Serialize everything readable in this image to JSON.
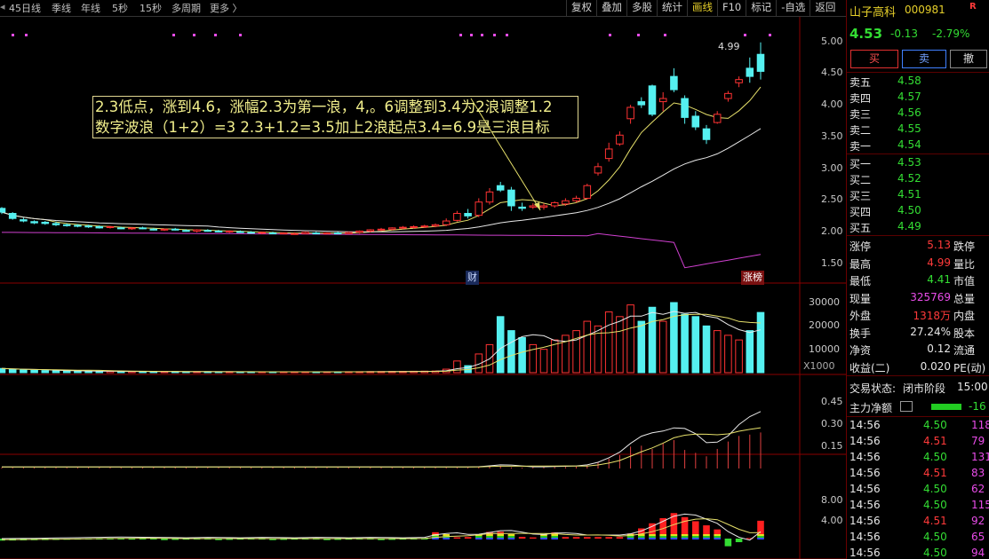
{
  "toolbar": {
    "left_items": [
      "45日线",
      "季线",
      "年线",
      "5秒",
      "15秒",
      "多周期",
      "更多 〉"
    ],
    "right_tabs": [
      "复权",
      "叠加",
      "多股",
      "统计",
      "画线",
      "F10",
      "标记",
      "-自选",
      "返回"
    ],
    "active_tab": "画线"
  },
  "annotation": {
    "line1": "2.3低点，涨到4.6，涨幅2.3为第一浪，4,。6调整到3.4为2浪调整1.2",
    "line2": "数字波浪（1+2）=3   2.3+1.2=3.5加上2浪起点3.4=6.9是三浪目标"
  },
  "labels": {
    "cai": "财",
    "zhangbang": "涨榜",
    "x1000": "X1000"
  },
  "axes": {
    "price": [
      "5.00",
      "4.50",
      "4.00",
      "3.50",
      "3.00",
      "2.50",
      "2.00",
      "1.50"
    ],
    "volume": [
      "30000",
      "20000",
      "10000"
    ],
    "ind1": [
      "0.45",
      "0.30",
      "0.15"
    ],
    "ind2": [
      "8.00",
      "4.00"
    ]
  },
  "chart_data": {
    "type": "candlestick",
    "high_label": "4.99",
    "candles": [
      [
        2.36,
        2.38,
        2.27,
        2.3
      ],
      [
        2.28,
        2.3,
        2.18,
        2.2
      ],
      [
        2.18,
        2.21,
        2.14,
        2.16
      ],
      [
        2.15,
        2.17,
        2.11,
        2.13
      ],
      [
        2.14,
        2.16,
        2.1,
        2.12
      ],
      [
        2.12,
        2.15,
        2.08,
        2.1
      ],
      [
        2.1,
        2.12,
        2.07,
        2.09
      ],
      [
        2.09,
        2.11,
        2.06,
        2.08
      ],
      [
        2.08,
        2.1,
        2.05,
        2.07
      ],
      [
        2.07,
        2.09,
        2.04,
        2.05
      ],
      [
        2.06,
        2.08,
        2.04,
        2.07
      ],
      [
        2.05,
        2.07,
        2.03,
        2.04
      ],
      [
        2.04,
        2.06,
        2.02,
        2.05
      ],
      [
        2.05,
        2.07,
        2.03,
        2.04
      ],
      [
        2.03,
        2.05,
        2.01,
        2.02
      ],
      [
        2.02,
        2.04,
        2.0,
        2.03
      ],
      [
        2.03,
        2.05,
        2.01,
        2.02
      ],
      [
        2.01,
        2.03,
        1.99,
        2.0
      ],
      [
        2.0,
        2.03,
        1.98,
        2.02
      ],
      [
        2.01,
        2.03,
        1.99,
        2.0
      ],
      [
        2.0,
        2.02,
        1.98,
        1.99
      ],
      [
        1.99,
        2.01,
        1.97,
        2.0
      ],
      [
        1.99,
        2.01,
        1.97,
        1.98
      ],
      [
        1.98,
        2.0,
        1.96,
        1.97
      ],
      [
        1.97,
        1.99,
        1.95,
        1.98
      ],
      [
        1.97,
        1.99,
        1.95,
        1.96
      ],
      [
        1.96,
        1.98,
        1.95,
        1.97
      ],
      [
        1.96,
        1.98,
        1.95,
        1.96
      ],
      [
        1.96,
        1.99,
        1.95,
        1.98
      ],
      [
        1.97,
        1.99,
        1.95,
        1.96
      ],
      [
        1.96,
        1.98,
        1.95,
        1.97
      ],
      [
        1.97,
        1.99,
        1.95,
        1.96
      ],
      [
        1.96,
        1.99,
        1.95,
        1.98
      ],
      [
        1.98,
        2.01,
        1.96,
        2.0
      ],
      [
        2.0,
        2.03,
        1.98,
        2.02
      ],
      [
        2.02,
        2.05,
        2.0,
        2.03
      ],
      [
        2.03,
        2.06,
        2.01,
        2.05
      ],
      [
        2.05,
        2.08,
        2.03,
        2.06
      ],
      [
        2.06,
        2.09,
        2.04,
        2.07
      ],
      [
        2.07,
        2.1,
        2.05,
        2.08
      ],
      [
        2.08,
        2.12,
        2.06,
        2.1
      ],
      [
        2.1,
        2.2,
        2.08,
        2.16
      ],
      [
        2.17,
        2.32,
        2.15,
        2.28
      ],
      [
        2.28,
        2.35,
        2.2,
        2.24
      ],
      [
        2.25,
        2.52,
        2.22,
        2.46
      ],
      [
        2.46,
        2.68,
        2.42,
        2.62
      ],
      [
        2.72,
        2.78,
        2.62,
        2.65
      ],
      [
        2.65,
        2.7,
        2.32,
        2.4
      ],
      [
        2.38,
        2.45,
        2.32,
        2.36
      ],
      [
        2.38,
        2.44,
        2.35,
        2.4
      ],
      [
        2.38,
        2.44,
        2.34,
        2.4
      ],
      [
        2.4,
        2.47,
        2.37,
        2.45
      ],
      [
        2.43,
        2.52,
        2.4,
        2.48
      ],
      [
        2.48,
        2.56,
        2.45,
        2.52
      ],
      [
        2.52,
        2.75,
        2.5,
        2.72
      ],
      [
        2.92,
        3.08,
        2.88,
        3.02
      ],
      [
        3.15,
        3.4,
        3.1,
        3.3
      ],
      [
        3.38,
        3.58,
        3.35,
        3.52
      ],
      [
        3.78,
        4.0,
        3.7,
        3.96
      ],
      [
        4.05,
        4.12,
        3.95,
        4.0
      ],
      [
        4.3,
        4.32,
        3.82,
        3.85
      ],
      [
        4.05,
        4.2,
        3.9,
        4.1
      ],
      [
        4.45,
        4.58,
        4.2,
        4.24
      ],
      [
        4.1,
        4.15,
        3.7,
        3.8
      ],
      [
        3.82,
        3.9,
        3.6,
        3.65
      ],
      [
        3.62,
        3.68,
        3.38,
        3.45
      ],
      [
        3.72,
        3.9,
        3.7,
        3.85
      ],
      [
        4.1,
        4.22,
        4.05,
        4.18
      ],
      [
        4.35,
        4.45,
        4.28,
        4.4
      ],
      [
        4.58,
        4.75,
        4.35,
        4.45
      ],
      [
        4.8,
        4.99,
        4.4,
        4.53
      ]
    ],
    "volume": [
      1800,
      1500,
      1200,
      1000,
      900,
      800,
      700,
      650,
      600,
      580,
      550,
      500,
      480,
      460,
      450,
      440,
      420,
      400,
      420,
      400,
      380,
      400,
      380,
      360,
      380,
      360,
      350,
      360,
      380,
      360,
      350,
      380,
      400,
      420,
      450,
      480,
      500,
      550,
      600,
      650,
      700,
      1500,
      5000,
      3000,
      8000,
      12000,
      24000,
      18000,
      15000,
      12000,
      10000,
      14000,
      16000,
      18000,
      22000,
      20000,
      26000,
      24000,
      29000,
      22000,
      28000,
      22000,
      30000,
      25000,
      24000,
      20000,
      18000,
      16000,
      14000,
      18000,
      25769
    ]
  },
  "panel": {
    "stock_name": "山子高科",
    "stock_code": "000981",
    "r_badge": "R",
    "price": "4.53",
    "change": "-0.13",
    "change_pct": "-2.79%",
    "buy_btn": "买",
    "sell_btn": "卖",
    "cancel_btn": "撤",
    "sells": [
      {
        "label": "卖五",
        "price": "4.58"
      },
      {
        "label": "卖四",
        "price": "4.57"
      },
      {
        "label": "卖三",
        "price": "4.56"
      },
      {
        "label": "卖二",
        "price": "4.55"
      },
      {
        "label": "卖一",
        "price": "4.54"
      }
    ],
    "buys": [
      {
        "label": "买一",
        "price": "4.53"
      },
      {
        "label": "买二",
        "price": "4.52"
      },
      {
        "label": "买三",
        "price": "4.51"
      },
      {
        "label": "买四",
        "price": "4.50"
      },
      {
        "label": "买五",
        "price": "4.49"
      }
    ],
    "stats": [
      {
        "l1": "涨停",
        "v1": "5.13",
        "l2": "跌停"
      },
      {
        "l1": "最高",
        "v1": "4.99",
        "l2": "量比"
      },
      {
        "l1": "最低",
        "v1": "4.41",
        "l2": "市值"
      },
      {
        "l1": "现量",
        "v1": "325769",
        "l2": "总量"
      },
      {
        "l1": "外盘",
        "v1": "1318万",
        "l2": "内盘"
      },
      {
        "l1": "换手",
        "v1": "27.24%",
        "l2": "股本"
      },
      {
        "l1": "净资",
        "v1": "0.12",
        "l2": "流通"
      },
      {
        "l1": "收益(二)",
        "v1": "0.020",
        "l2": "PE(动)"
      }
    ],
    "trade_status_label": "交易状态:",
    "trade_status": "闭市阶段",
    "trade_time": "15:00",
    "main_net_label": "主力净额",
    "main_net_val": "-16",
    "ticks": [
      {
        "time": "14:56",
        "price": "4.50",
        "vol": "118"
      },
      {
        "time": "14:56",
        "price": "4.51",
        "vol": "79"
      },
      {
        "time": "14:56",
        "price": "4.50",
        "vol": "131"
      },
      {
        "time": "14:56",
        "price": "4.51",
        "vol": "83"
      },
      {
        "time": "14:56",
        "price": "4.50",
        "vol": "62"
      },
      {
        "time": "14:56",
        "price": "4.50",
        "vol": "115"
      },
      {
        "time": "14:56",
        "price": "4.51",
        "vol": "92"
      },
      {
        "time": "14:56",
        "price": "4.50",
        "vol": "65"
      },
      {
        "time": "14:56",
        "price": "4.50",
        "vol": "94"
      }
    ]
  }
}
